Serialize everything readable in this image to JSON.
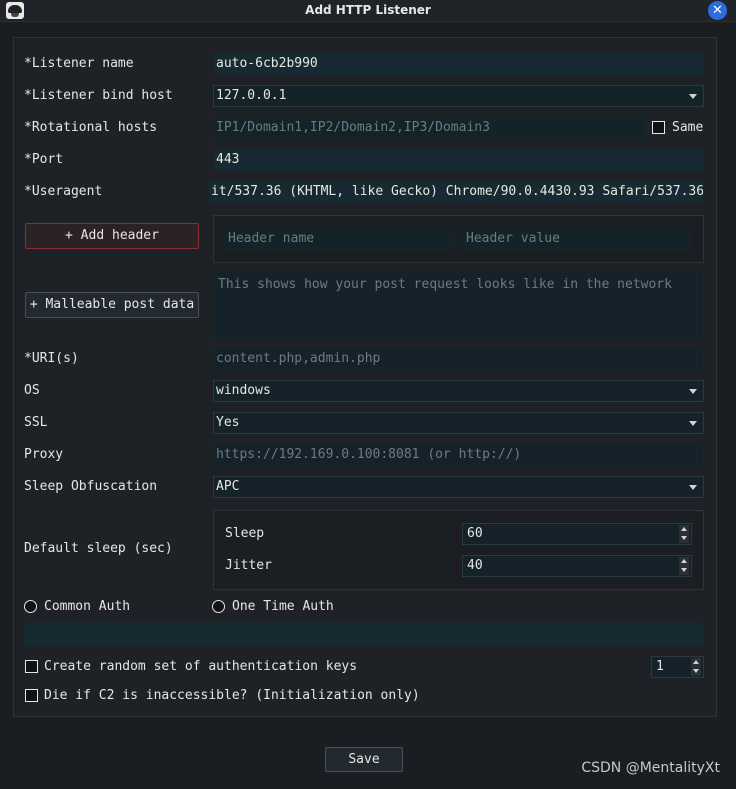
{
  "window": {
    "title": "Add HTTP Listener",
    "icon": "havoc-logo-icon",
    "close_icon": "close-icon",
    "accent_color": "#2d6be0"
  },
  "form": {
    "listener_name": {
      "label": "*Listener name",
      "value": "auto-6cb2b990"
    },
    "bind_host": {
      "label": "*Listener bind host",
      "value": "127.0.0.1"
    },
    "rotational_hosts": {
      "label": "*Rotational hosts",
      "placeholder": "IP1/Domain1,IP2/Domain2,IP3/Domain3",
      "same_label": "Same"
    },
    "port": {
      "label": "*Port",
      "value": "443"
    },
    "useragent": {
      "label": "*Useragent",
      "value": "it/537.36 (KHTML, like Gecko) Chrome/90.0.4430.93 Safari/537.36"
    },
    "headers": {
      "button": "+ Add header",
      "name_placeholder": "Header name",
      "value_placeholder": "Header value"
    },
    "malleable": {
      "button": "+ Malleable post data",
      "placeholder": "This shows how your post request looks like in the network"
    },
    "uris": {
      "label": "*URI(s)",
      "placeholder": "content.php,admin.php"
    },
    "os": {
      "label": "OS",
      "value": "windows"
    },
    "ssl": {
      "label": "SSL",
      "value": "Yes"
    },
    "proxy": {
      "label": "Proxy",
      "placeholder": "https://192.169.0.100:8081 (or http://)"
    },
    "sleep_obfuscation": {
      "label": "Sleep Obfuscation",
      "value": "APC"
    },
    "default_sleep": {
      "label": "Default sleep (sec)",
      "sleep_label": "Sleep",
      "sleep_value": "60",
      "jitter_label": "Jitter",
      "jitter_value": "40"
    },
    "auth": {
      "common": "Common Auth",
      "one_time": "One Time Auth",
      "token_value": ""
    },
    "random_keys": {
      "label": "Create random set of authentication keys",
      "count": "1"
    },
    "die_if_inaccessible": {
      "label": "Die if C2 is inaccessible? (Initialization only)"
    }
  },
  "footer": {
    "save_label": "Save"
  },
  "watermark": "CSDN @MentalityXt"
}
